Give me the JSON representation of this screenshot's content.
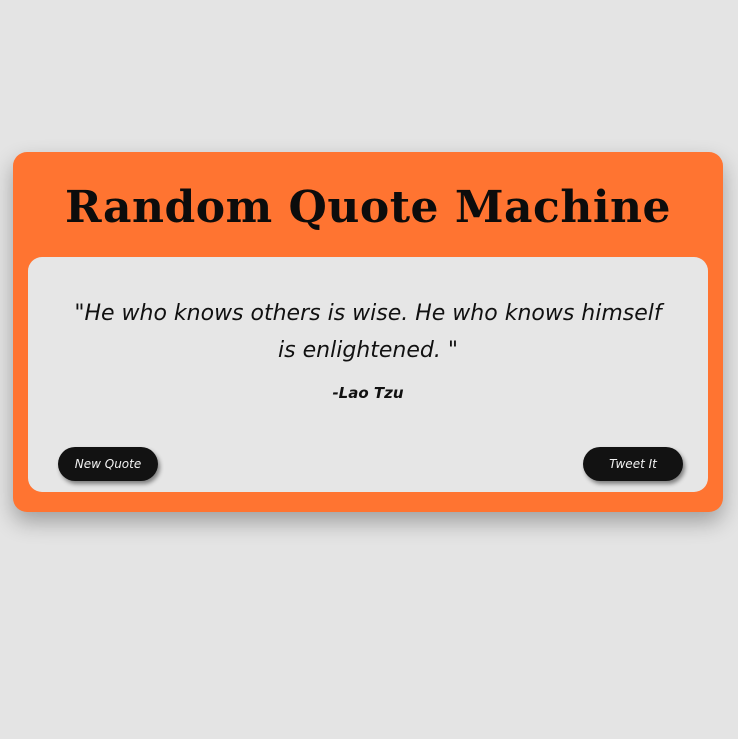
{
  "app": {
    "title": "Random Quote Machine"
  },
  "quote": {
    "text": "\"He who knows others is wise. He who knows himself is enlightened. \"",
    "author": "-Lao Tzu"
  },
  "actions": {
    "new_quote_label": "New Quote",
    "tweet_label": "Tweet It"
  },
  "colors": {
    "page_background": "#e4e4e4",
    "card_background": "#ff7431",
    "quote_box_background": "#e6e6e6",
    "button_background": "#121212",
    "button_text": "#f2f2f2",
    "text": "#111111"
  }
}
